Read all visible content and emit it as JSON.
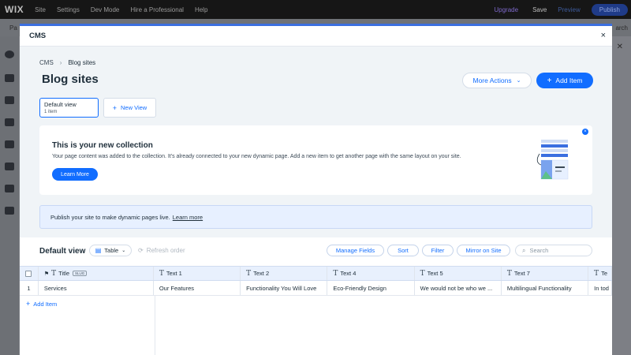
{
  "editor": {
    "logo": "WIX",
    "menu": [
      "Site",
      "Settings",
      "Dev Mode",
      "Hire a Professional",
      "Help"
    ],
    "upgrade": "Upgrade",
    "save": "Save",
    "preview": "Preview",
    "publish": "Publish",
    "sub_left": "Pa",
    "sub_right": "arch"
  },
  "modal": {
    "title": "CMS",
    "close": "×"
  },
  "cms": {
    "breadcrumb": [
      "CMS",
      "Blog sites"
    ],
    "page_title": "Blog sites",
    "more_actions": "More Actions",
    "add_item": "Add Item",
    "view_card_title": "Default view",
    "view_card_sub": "1 item",
    "new_view": "New View"
  },
  "banner": {
    "title": "This is your new collection",
    "text": "Your page content was added to the collection. It's already connected to your new dynamic page. Add a new item to get another page with the same layout on your site.",
    "button": "Learn More"
  },
  "publish_note": {
    "text": "Publish your site to make dynamic pages live.",
    "link": "Learn more"
  },
  "table_toolbar": {
    "title": "Default view",
    "table_label": "Table",
    "refresh": "Refresh order",
    "manage_fields": "Manage Fields",
    "sort": "Sort",
    "filter": "Filter",
    "mirror": "Mirror on Site",
    "search_placeholder": "Search"
  },
  "table": {
    "columns": [
      "Title",
      "Text 1",
      "Text 2",
      "Text 4",
      "Text 5",
      "Text 7",
      "Te"
    ],
    "slug": "SLUG",
    "rows": [
      {
        "index": "1",
        "cells": [
          "Services",
          "Our Features",
          "Functionality You Will Love",
          "Eco-Friendly Design",
          "We would not be who we ...",
          "Multilingual Functionality",
          "In tod"
        ]
      }
    ],
    "add_item": "Add Item"
  },
  "colors": {
    "accent": "#116dff",
    "header_bg": "#e8f0fd",
    "note_bg": "#e7f0ff"
  }
}
